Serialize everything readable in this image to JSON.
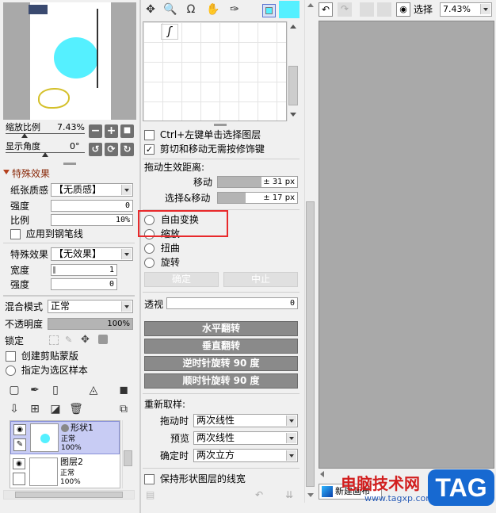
{
  "navigator": {
    "zoom_label": "缩放比例",
    "zoom_value": "7.43%",
    "angle_label": "显示角度",
    "angle_value": "0°"
  },
  "effects": {
    "header": "特殊效果",
    "texture_label": "纸张质感",
    "texture_value": "【无质感】",
    "strength_label": "强度",
    "strength_value": "0",
    "ratio_label": "比例",
    "ratio_value": "10%",
    "apply_brush_label": "应用到钢笔线",
    "effect_label": "特殊效果",
    "effect_value": "【无效果】",
    "width_label": "宽度",
    "width_value": "1",
    "strength2_label": "强度",
    "strength2_value": "0"
  },
  "layer_props": {
    "blend_label": "混合模式",
    "blend_value": "正常",
    "opacity_label": "不透明度",
    "opacity_value": "100%",
    "opacity_fill": 1.0,
    "lock_label": "锁定",
    "clip_label": "创建剪贴蒙版",
    "select_src_label": "指定为选区样本"
  },
  "layers": [
    {
      "name": "形状1",
      "mode": "正常",
      "opacity": "100%",
      "selected": true
    },
    {
      "name": "图层2",
      "mode": "正常",
      "opacity": "100%",
      "selected": false
    }
  ],
  "tool_options": {
    "ctrl_click_label": "Ctrl+左键单击选择图层",
    "ctrl_click_checked": false,
    "cut_move_label": "剪切和移动无需按修饰键",
    "cut_move_checked": true,
    "drag_dist_label": "拖动生效距离:",
    "move_label": "移动",
    "move_value": "± 31 px",
    "move_fill": 0.55,
    "sel_move_label": "选择&移动",
    "sel_move_value": "± 17 px",
    "sel_move_fill": 0.35,
    "transform_options": [
      "自由变换",
      "缩放",
      "扭曲",
      "旋转"
    ],
    "ok_label": "确定",
    "cancel_label": "中止",
    "perspective_label": "透视",
    "perspective_value": "0",
    "flip_h": "水平翻转",
    "flip_v": "垂直翻转",
    "rot_ccw": "逆时针旋转 90 度",
    "rot_cw": "顺时针旋转 90 度",
    "resample_label": "重新取样:",
    "drag_label": "拖动时",
    "drag_value": "两次线性",
    "preview_label": "预览",
    "preview_value": "两次线性",
    "confirm_label": "确定时",
    "confirm_value": "两次立方",
    "keep_shape_label": "保持形状图层的线宽"
  },
  "toolbar": {
    "select_label": "选择",
    "zoom_value": "7.43%",
    "cyan_color": "#55f0ff"
  },
  "bottom": {
    "new_canvas_label": "新建画布",
    "watermark_title": "电脑技术网",
    "watermark_url": "www.tagxp.com",
    "tag_label": "TAG"
  },
  "colors": {
    "highlight_red": "#e8292b",
    "layer_selected_bg": "#c8ccf4",
    "shape_cyan": "#55f0ff",
    "shape_yellow": "#d4c02a",
    "canvas_gray": "#a9a9a9"
  }
}
